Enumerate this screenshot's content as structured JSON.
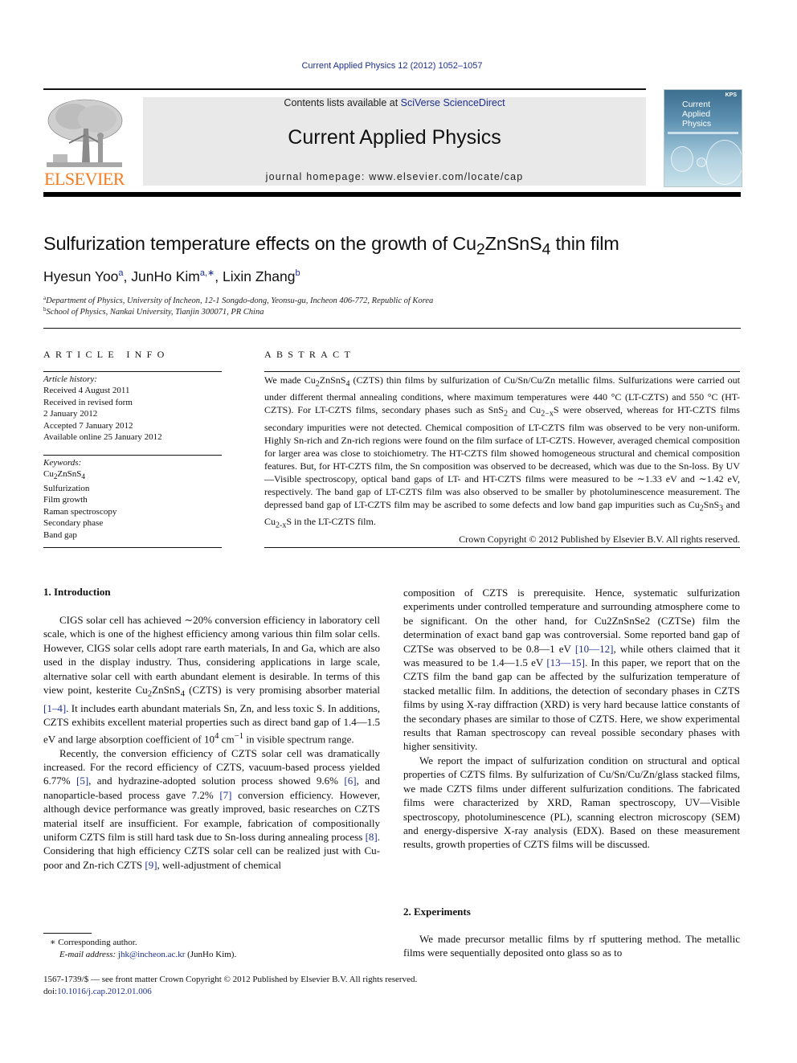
{
  "header": {
    "journal_reference": "Current Applied Physics 12 (2012) 1052–1057",
    "contents_prefix": "Contents lists available at ",
    "contents_link": "SciVerse ScienceDirect",
    "journal_title": "Current Applied Physics",
    "homepage": "journal homepage: www.elsevier.com/locate/cap",
    "publisher_logo_text": "ELSEVIER",
    "cover": {
      "title_lines": [
        "Current",
        "Applied",
        "Physics"
      ],
      "badge": "KPS"
    },
    "colors": {
      "link": "#1d2f8f",
      "elsevier_orange": "#f47b20",
      "banner_bg": "#e9e9e9"
    }
  },
  "article": {
    "title_pre": "Sulfurization temperature effects on the growth of Cu",
    "title_sub1": "2",
    "title_mid": "ZnSnS",
    "title_sub2": "4",
    "title_post": " thin film",
    "authors": [
      {
        "name": "Hyesun Yoo",
        "sup": "a"
      },
      {
        "name": "JunHo Kim",
        "sup": "a,∗"
      },
      {
        "name": "Lixin Zhang",
        "sup": "b"
      }
    ],
    "affiliations": [
      {
        "mark": "a",
        "text": "Department of Physics, University of Incheon, 12-1 Songdo-dong, Yeonsu-gu, Incheon 406-772, Republic of Korea"
      },
      {
        "mark": "b",
        "text": "School of Physics, Nankai University, Tianjin 300071, PR China"
      }
    ]
  },
  "article_info": {
    "heading": "ARTICLE INFO",
    "history_label": "Article history:",
    "history": [
      "Received 4 August 2011",
      "Received in revised form",
      "2 January 2012",
      "Accepted 7 January 2012",
      "Available online 25 January 2012"
    ],
    "keywords_label": "Keywords:",
    "keyword_formula": {
      "a": "Cu",
      "s1": "2",
      "b": "ZnSnS",
      "s2": "4"
    },
    "keywords": [
      "Sulfurization",
      "Film growth",
      "Raman spectroscopy",
      "Secondary phase",
      "Band gap"
    ]
  },
  "abstract": {
    "heading": "ABSTRACT",
    "p1": "We made Cu",
    "p1_s1": "2",
    "p1_b": "ZnSnS",
    "p1_s2": "4",
    "p2": " (CZTS) thin films by sulfurization of Cu/Sn/Cu/Zn metallic films. Sulfurizations were carried out under different thermal annealing conditions, where maximum temperatures were 440 °C (LT-CZTS) and 550 °C (HT-CZTS). For LT-CZTS films, secondary phases such as SnS",
    "p2_s": "2",
    "p3": " and Cu",
    "p3_s": "2−x",
    "p4": "S were observed, whereas for HT-CZTS films secondary impurities were not detected. Chemical composition of LT-CZTS film was observed to be very non-uniform. Highly Sn-rich and Zn-rich regions were found on the film surface of LT-CZTS. However, averaged chemical composition for larger area was close to stoichiometry. The HT-CZTS film showed homogeneous structural and chemical composition features. But, for HT-CZTS film, the Sn composition was observed to be decreased, which was due to the Sn-loss. By UV—Visible spectroscopy, optical band gaps of LT- and HT-CZTS films were measured to be ∼1.33 eV and ∼1.42 eV, respectively. The band gap of LT-CZTS film was also observed to be smaller by photoluminescence measurement. The depressed band gap of LT-CZTS film may be ascribed to some defects and low band gap impurities such as Cu",
    "p4_s1": "2",
    "p5": "SnS",
    "p5_s": "3",
    "p6": " and Cu",
    "p6_s": "2-x",
    "p7": "S in the LT-CZTS film.",
    "copyright": "Crown Copyright © 2012 Published by Elsevier B.V. All rights reserved."
  },
  "intro": {
    "heading": "1.  Introduction",
    "para1_a": "CIGS solar cell has achieved ∼20% conversion efficiency in laboratory cell scale, which is one of the highest efficiency among various thin film solar cells. However, CIGS solar cells adopt rare earth materials, In and Ga, which are also used in the display industry. Thus, considering applications in large scale, alternative solar cell with earth abundant element is desirable. In terms of this view point, kesterite Cu",
    "para1_s1": "2",
    "para1_b": "ZnSnS",
    "para1_s2": "4",
    "para1_c": " (CZTS) is very promising absorber material ",
    "ref_1_4": "[1–4]",
    "para1_d": ". It includes earth abundant materials Sn, Zn, and less toxic S. In additions, CZTS exhibits excellent material properties such as direct band gap of 1.4—1.5 eV and large absorption coefficient of 10",
    "para1_exp1": "4",
    "para1_e": " cm",
    "para1_exp2": "−1",
    "para1_f": " in visible spectrum range.",
    "para2_a": "Recently, the conversion efficiency of CZTS solar cell was dramatically increased. For the record efficiency of CZTS, vacuum-based process yielded 6.77% ",
    "ref_5": "[5]",
    "para2_b": ", and hydrazine-adopted solution process showed 9.6% ",
    "ref_6": "[6]",
    "para2_c": ", and nanoparticle-based process gave 7.2% ",
    "ref_7": "[7]",
    "para2_d": " conversion efficiency. However, although device performance was greatly improved, basic researches on CZTS material itself are insufficient. For example, fabrication of compositionally uniform CZTS film is still hard task due to Sn-loss during annealing process ",
    "ref_8": "[8]",
    "para2_e": ". Considering that high efficiency CZTS solar cell can be realized just with Cu-poor and Zn-rich CZTS ",
    "ref_9": "[9]",
    "para2_f": ", well-adjustment of chemical",
    "para3_a": "composition of CZTS is prerequisite. Hence, systematic sulfurization experiments under controlled temperature and surrounding atmosphere come to be significant. On the other hand, for Cu2ZnSnSe2 (CZTSe) film the determination of exact band gap was controversial. Some reported band gap of CZTSe was observed to be 0.8—1 eV ",
    "ref_10_12": "[10—12]",
    "para3_b": ", while others claimed that it was measured to be 1.4—1.5 eV ",
    "ref_13_15": "[13—15]",
    "para3_c": ". In this paper, we report that on the CZTS film the band gap can be affected by the sulfurization temperature of stacked metallic film. In additions, the detection of secondary phases in CZTS films by using X-ray diffraction (XRD) is very hard because lattice constants of the secondary phases are similar to those of CZTS. Here, we show experimental results that Raman spectroscopy can reveal possible secondary phases with higher sensitivity.",
    "para4": "We report the impact of sulfurization condition on structural and optical properties of CZTS films. By sulfurization of Cu/Sn/Cu/Zn/glass stacked films, we made CZTS films under different sulfurization conditions. The fabricated films were characterized by XRD, Raman spectroscopy, UV—Visible spectroscopy, photoluminescence (PL), scanning electron microscopy (SEM) and energy-dispersive X-ray analysis (EDX). Based on these measurement results, growth properties of CZTS films will be discussed."
  },
  "experiments": {
    "heading": "2.  Experiments",
    "para1": "We made precursor metallic films by rf sputtering method. The metallic films were sequentially deposited onto glass so as to"
  },
  "footnote": {
    "star_label": "∗ Corresponding author.",
    "email_label": "E-mail address: ",
    "email": "jhk@incheon.ac.kr",
    "email_suffix": " (JunHo Kim)."
  },
  "footer": {
    "issn_line": "1567-1739/$ — see front matter Crown Copyright © 2012 Published by Elsevier B.V. All rights reserved.",
    "doi_prefix": "doi:",
    "doi": "10.1016/j.cap.2012.01.006"
  }
}
